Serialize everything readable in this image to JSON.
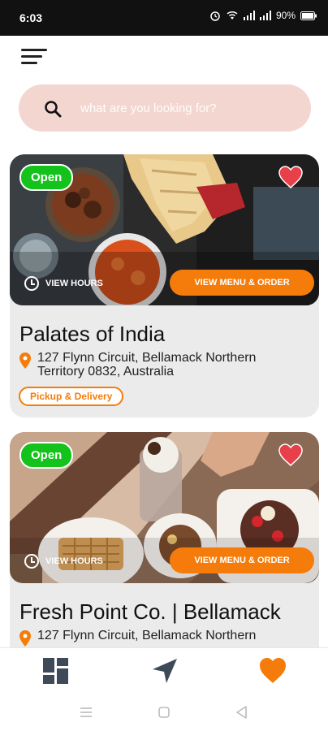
{
  "status_bar": {
    "time": "6:03",
    "battery": "90%"
  },
  "search": {
    "placeholder": "what are you looking for?"
  },
  "colors": {
    "accent": "#f57c0a",
    "open_badge": "#13c21a",
    "search_bg": "#f3d6d0",
    "heart": "#e8404a",
    "card_bg": "#ebebeb"
  },
  "restaurants": [
    {
      "status": "Open",
      "view_hours": "VIEW HOURS",
      "action": "VIEW MENU & ORDER",
      "name": "Palates of India",
      "address": "127 Flynn Circuit, Bellamack Northern Territory 0832, Australia",
      "service": "Pickup & Delivery",
      "favorited": true
    },
    {
      "status": "Open",
      "view_hours": "VIEW HOURS",
      "action": "VIEW MENU & ORDER",
      "name": "Fresh Point Co. | Bellamack",
      "address": "127 Flynn Circuit, Bellamack Northern",
      "favorited": true
    }
  ],
  "bottom_nav": {
    "items": [
      {
        "icon": "grid-icon",
        "name": "home"
      },
      {
        "icon": "navigation-arrow-icon",
        "name": "nearby"
      },
      {
        "icon": "heart-icon",
        "name": "favorites",
        "active": true
      }
    ]
  },
  "system_nav": [
    "menu-lines-icon",
    "home-square-icon",
    "back-triangle-icon"
  ]
}
